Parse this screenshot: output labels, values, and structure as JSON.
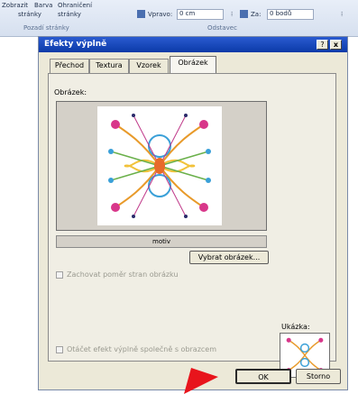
{
  "ribbon": {
    "items": [
      "Zobrazit",
      "Barva",
      "Ohraničení"
    ],
    "group1": [
      "stránky",
      "stránky"
    ],
    "group2_label": "Pozadí stránky",
    "indent_label": "Vpravo:",
    "indent_value": "0 cm",
    "spacing_label": "Za:",
    "spacing_value": "0 bodů",
    "group3_label": "Odstavec"
  },
  "dialog": {
    "title": "Efekty výplně",
    "help_label": "?",
    "close_label": "x",
    "tabs": [
      {
        "label": "Přechod"
      },
      {
        "label": "Textura"
      },
      {
        "label": "Vzorek"
      },
      {
        "label": "Obrázek"
      }
    ],
    "picture_label": "Obrázek:",
    "picture_name": "motiv",
    "select_picture_button": "Vybrat obrázek...",
    "lock_ratio_label": "Zachovat poměr stran obrázku",
    "rotate_label": "Otáčet efekt výplně společně s obrazcem",
    "sample_label": "Ukázka:",
    "ok_button": "OK",
    "cancel_button": "Storno"
  },
  "colors": {
    "title_bar": "#0b3aa8",
    "dialog_bg": "#ece9d8",
    "arrow": "#e8141c"
  }
}
